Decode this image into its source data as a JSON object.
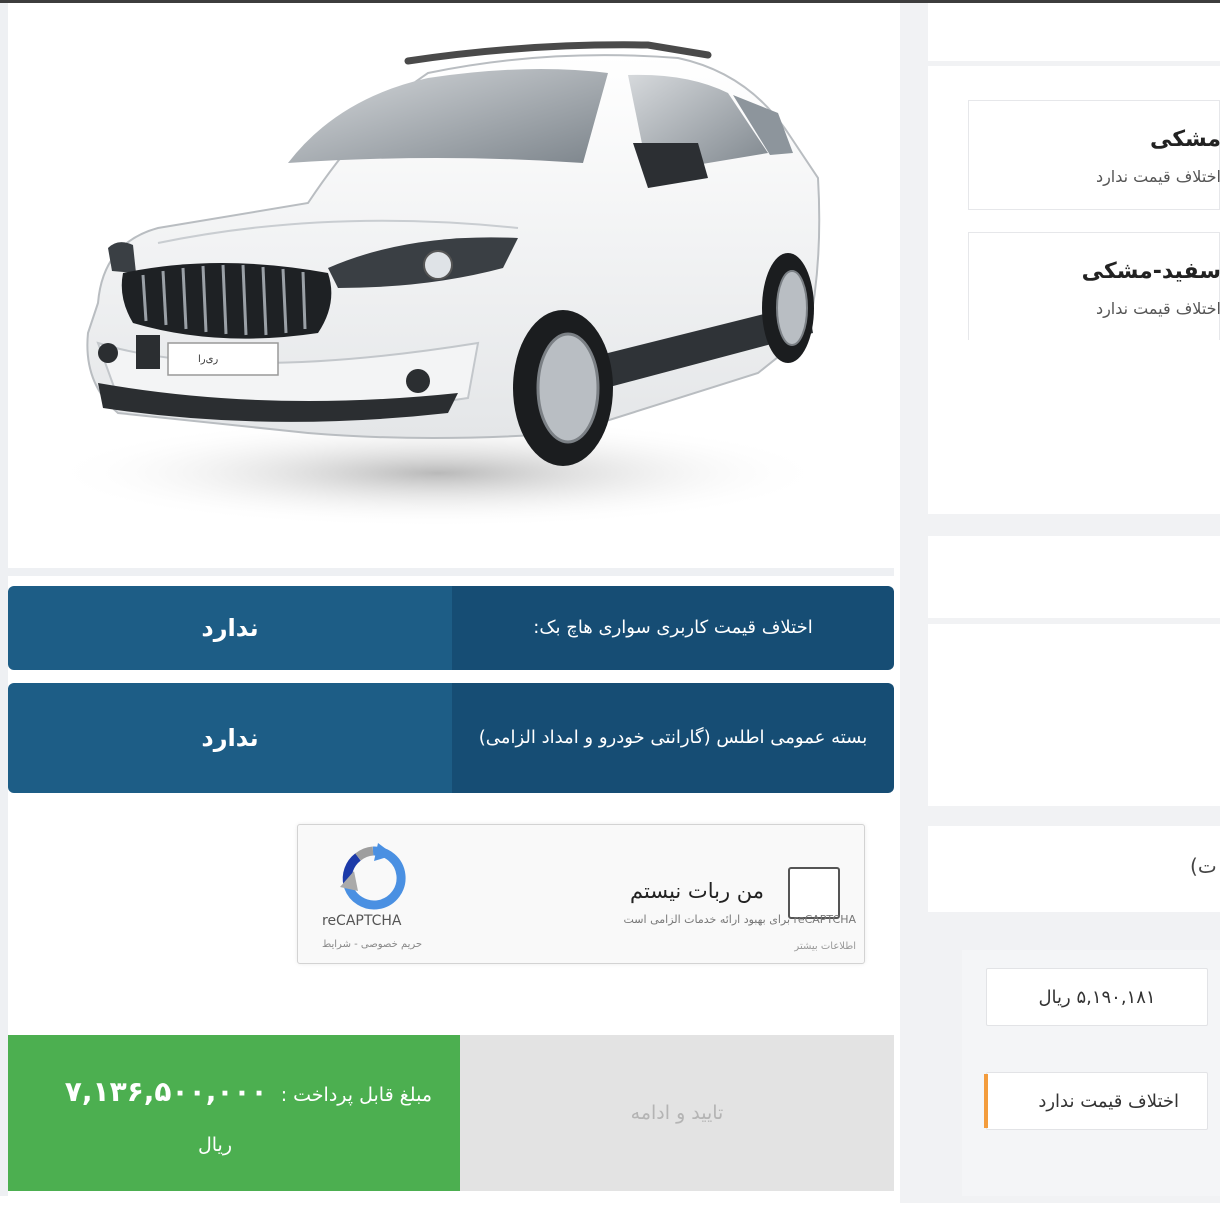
{
  "car": {
    "badge_text": "ری‌را"
  },
  "info_rows": [
    {
      "label": "اختلاف قیمت کاربری سواری هاچ بک:",
      "value": "ندارد"
    },
    {
      "label": "بسته عمومی اطلس (گارانتی خودرو و امداد الزامی)",
      "value": "ندارد"
    }
  ],
  "captcha": {
    "label": "من ربات نیستم",
    "brand": "reCAPTCHA",
    "privacy": "حریم خصوصی - شرایط",
    "terms": "reCAPTCHA برای بهبود ارائه خدمات الزامی است",
    "more": "اطلاعات بیشتر"
  },
  "payment": {
    "label": "مبلغ قابل پرداخت :",
    "amount": "۷,۱۳۶,۵۰۰,۰۰۰",
    "unit": "ریال",
    "confirm_label": "تایید و ادامه"
  },
  "sidebar": {
    "colors": [
      {
        "name": "مشکی",
        "diff": "اختلاف قیمت ندارد"
      },
      {
        "name": "سفید-مشکی",
        "diff": "اختلاف قیمت ندارد"
      }
    ],
    "fragment": "(ت",
    "price": "۵,۱۹۰,۱۸۱ ریال",
    "price_diff": "اختلاف قیمت ندارد"
  },
  "colors": {
    "info_blue": "#1d5d86",
    "info_blue_dark": "#164d74",
    "pay_green": "#4caf50",
    "accent_orange": "#f39c3d"
  }
}
